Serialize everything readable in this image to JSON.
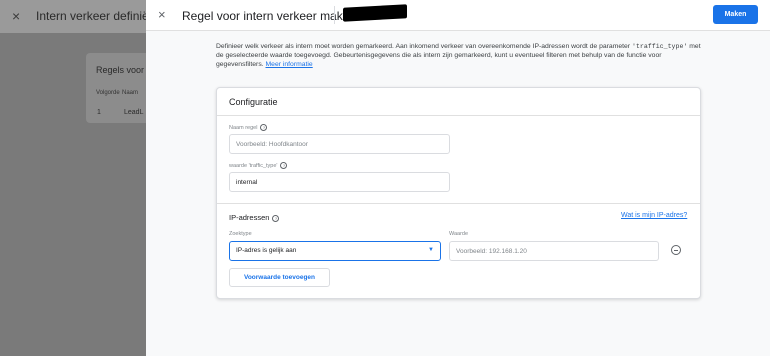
{
  "background_panel": {
    "close_icon": "×",
    "title": "Intern verkeer definiëren",
    "card_title": "Regels voor i",
    "col_order": "Volgorde",
    "col_name": "Naam",
    "row_order": "1",
    "row_name": "LeadL"
  },
  "dialog": {
    "close_icon": "×",
    "title": "Regel voor intern verkeer maken",
    "create_button": "Maken",
    "intro_part1": "Definieer welk verkeer als intern moet worden gemarkeerd. Aan inkomend verkeer van overeenkomende IP-adressen wordt de parameter ",
    "intro_code": "'traffic_type'",
    "intro_part2": " met de geselecteerde waarde toegevoegd. Gebeurtenisgegevens die als intern zijn gemarkeerd, kunt u eventueel filteren met behulp van de functie voor gegevensfilters. ",
    "intro_link": "Meer informatie"
  },
  "config": {
    "title": "Configuratie",
    "rule_name_label": "Naam regel",
    "rule_name_placeholder": "Voorbeeld: Hoofdkantoor",
    "traffic_type_label": "waarde 'traffic_type'",
    "traffic_type_value": "internal",
    "ip_title": "IP-adressen",
    "ip_link": "Wat is mijn IP-adres?",
    "match_type_label": "Zoektype",
    "match_type_value": "IP-adres is gelijk aan",
    "value_label": "Waarde",
    "value_placeholder": "Voorbeeld: 192.168.1.20",
    "add_condition_button": "Voorwaarde toevoegen"
  },
  "colors": {
    "accent": "#1a73e8",
    "overlay": "#7a7a7a"
  }
}
